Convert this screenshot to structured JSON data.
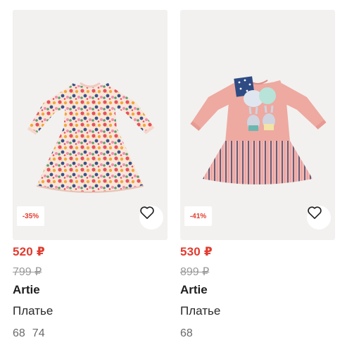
{
  "products": [
    {
      "discount": "-35%",
      "price": "520 ₽",
      "old_price": "799 ₽",
      "brand": "Artie",
      "category": "Платье",
      "sizes": [
        "68",
        "74"
      ],
      "favorite_icon": "heart-outline-icon",
      "image_subject": "floral-dress"
    },
    {
      "discount": "-41%",
      "price": "530 ₽",
      "old_price": "899 ₽",
      "brand": "Artie",
      "category": "Платье",
      "sizes": [
        "68"
      ],
      "favorite_icon": "heart-outline-icon",
      "image_subject": "pink-dress-with-bunnies"
    }
  ],
  "colors": {
    "accent_red": "#e23b2f",
    "old_price_gray": "#9a9a9a",
    "image_background": "#f2f1ef"
  }
}
